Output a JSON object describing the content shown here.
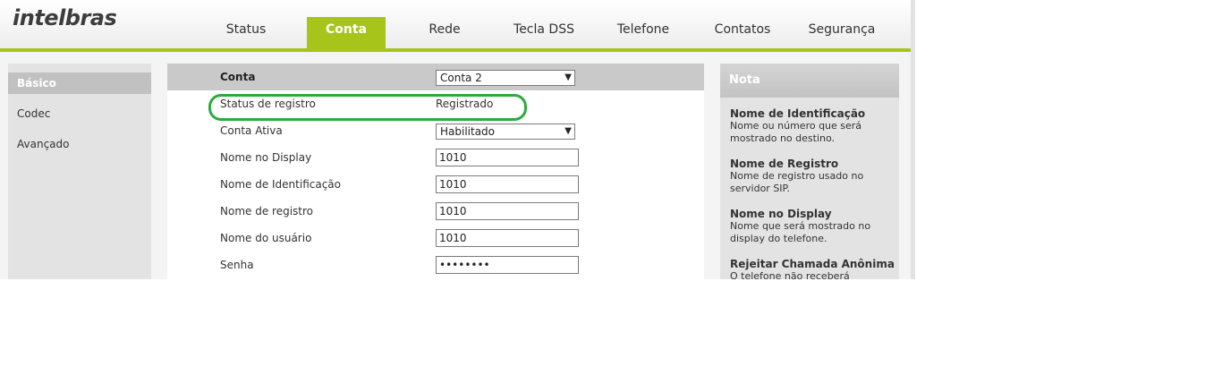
{
  "brand": {
    "logo_text": "intelbras",
    "accent_color": "#a6c41a"
  },
  "nav": {
    "tabs": [
      {
        "label": "Status",
        "active": false
      },
      {
        "label": "Conta",
        "active": true
      },
      {
        "label": "Rede",
        "active": false
      },
      {
        "label": "Tecla DSS",
        "active": false
      },
      {
        "label": "Telefone",
        "active": false
      },
      {
        "label": "Contatos",
        "active": false
      },
      {
        "label": "Segurança",
        "active": false
      }
    ]
  },
  "sidebar": {
    "items": [
      {
        "label": "Básico",
        "active": true
      },
      {
        "label": "Codec",
        "active": false
      },
      {
        "label": "Avançado",
        "active": false
      }
    ]
  },
  "form": {
    "account_label": "Conta",
    "account_selected": "Conta 2",
    "reg_status_label": "Status de registro",
    "reg_status_value": "Registrado",
    "active_label": "Conta Ativa",
    "active_selected": "Habilitado",
    "display_name_label": "Nome no Display",
    "display_name_value": "1010",
    "id_name_label": "Nome de Identificação",
    "id_name_value": "1010",
    "reg_name_label": "Nome de registro",
    "reg_name_value": "1010",
    "user_name_label": "Nome do usuário",
    "user_name_value": "1010",
    "password_label": "Senha",
    "password_value": "••••••••"
  },
  "note": {
    "title": "Nota",
    "entries": [
      {
        "title": "Nome de Identificação",
        "desc1": "Nome ou número que será",
        "desc2": "mostrado no destino."
      },
      {
        "title": "Nome de Registro",
        "desc1": "Nome de registro usado no",
        "desc2": "servidor SIP."
      },
      {
        "title": "Nome no Display",
        "desc1": "Nome que será mostrado no",
        "desc2": "display do telefone."
      },
      {
        "title": "Rejeitar Chamada Anônima",
        "desc1": "O telefone não receberá",
        "desc2": ""
      }
    ]
  }
}
